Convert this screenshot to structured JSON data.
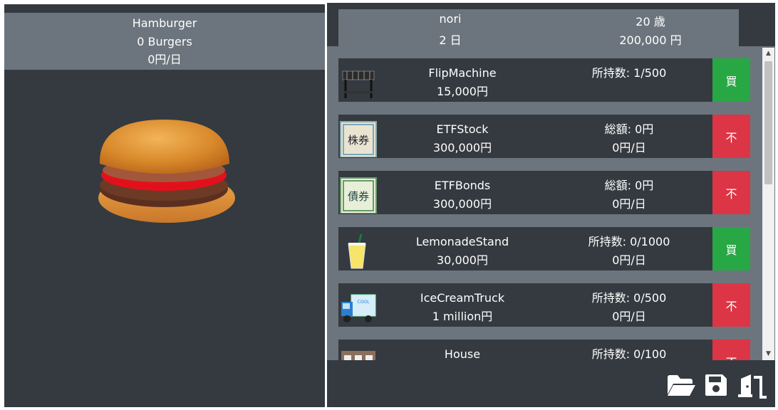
{
  "hamburger": {
    "title": "Hamburger",
    "count": "0 Burgers",
    "rate": "0円/日"
  },
  "profile": {
    "name": "nori",
    "age": "20 歳",
    "days": "2 日",
    "money": "200,000 円"
  },
  "items": [
    {
      "name": "FlipMachine",
      "price": "15,000円",
      "info1": "所持数: 1/500",
      "info2": "",
      "action": "買",
      "action_type": "buy",
      "icon": "grill-icon"
    },
    {
      "name": "ETFStock",
      "price": "300,000円",
      "info1": "総額: 0円",
      "info2": "0円/日",
      "action": "不",
      "action_type": "no",
      "icon": "stock-certificate-icon"
    },
    {
      "name": "ETFBonds",
      "price": "300,000円",
      "info1": "総額: 0円",
      "info2": "0円/日",
      "action": "不",
      "action_type": "no",
      "icon": "bond-certificate-icon"
    },
    {
      "name": "LemonadeStand",
      "price": "30,000円",
      "info1": "所持数: 0/1000",
      "info2": "0円/日",
      "action": "買",
      "action_type": "buy",
      "icon": "lemonade-icon"
    },
    {
      "name": "IceCreamTruck",
      "price": "1 million円",
      "info1": "所持数: 0/500",
      "info2": "0円/日",
      "action": "不",
      "action_type": "no",
      "icon": "ice-cream-truck-icon"
    },
    {
      "name": "House",
      "price": "",
      "info1": "所持数: 0/100",
      "info2": "",
      "action": "不",
      "action_type": "no",
      "icon": "house-icon"
    }
  ],
  "colors": {
    "panel": "#343a40",
    "header": "#6c757d",
    "buy": "#28a745",
    "no": "#dc3545"
  },
  "footer": {
    "icons": [
      "folder-open-icon",
      "save-icon",
      "exit-door-icon"
    ]
  }
}
